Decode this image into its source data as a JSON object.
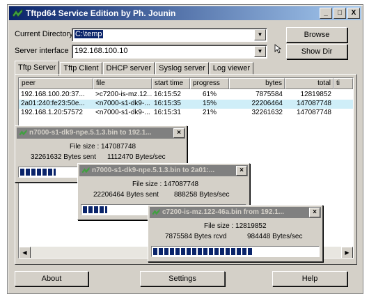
{
  "window": {
    "title": "Tftpd64 Service Edition by Ph. Jounin",
    "minimize": "_",
    "maximize": "□",
    "close": "X"
  },
  "settings_area": {
    "current_directory_label": "Current Directory",
    "current_directory_value": "C:\\temp",
    "server_interface_label": "Server interface",
    "server_interface_value": "192.168.100.10",
    "browse_label": "Browse",
    "show_dir_label": "Show Dir"
  },
  "tabs": [
    {
      "label": "Tftp Server",
      "active": true
    },
    {
      "label": "Tftp Client"
    },
    {
      "label": "DHCP server"
    },
    {
      "label": "Syslog server"
    },
    {
      "label": "Log viewer"
    }
  ],
  "table": {
    "columns": [
      "peer",
      "file",
      "start time",
      "progress",
      "bytes",
      "total",
      "ti"
    ],
    "rows": [
      [
        "192.168.100.20:37...",
        ">c7200-is-mz.12...",
        "16:15:52",
        "61%",
        "7875584",
        "12819852",
        ""
      ],
      [
        "2a01:240:fe23:50e...",
        "<n7000-s1-dk9-...",
        "16:15:35",
        "15%",
        "22206464",
        "147087748",
        ""
      ],
      [
        "192.168.1.20:57572",
        "<n7000-s1-dk9-...",
        "16:15:31",
        "21%",
        "32261632",
        "147087748",
        ""
      ]
    ]
  },
  "transfers": [
    {
      "title": "n7000-s1-dk9-npe.5.1.3.bin to 192.1...",
      "file_size": "File size : 147087748",
      "bytes": "32261632 Bytes sent",
      "rate": "1112470 Bytes/sec",
      "progress": 0.22
    },
    {
      "title": "n7000-s1-dk9-npe.5.1.3.bin to 2a01:...",
      "file_size": "File size : 147087748",
      "bytes": "22206464 Bytes sent",
      "rate": "888258 Bytes/sec",
      "progress": 0.15
    },
    {
      "title": "c7200-is-mz.122-46a.bin from 192.1...",
      "file_size": "File size : 12819852",
      "bytes": "7875584 Bytes rcvd",
      "rate": "984448 Bytes/sec",
      "progress": 0.61
    }
  ],
  "footer": {
    "about_label": "About",
    "settings_label": "Settings",
    "help_label": "Help"
  },
  "colors": {
    "titlebar": "#0a246a",
    "progress": "#0a246a",
    "highlight_row": "#cfeef8"
  }
}
